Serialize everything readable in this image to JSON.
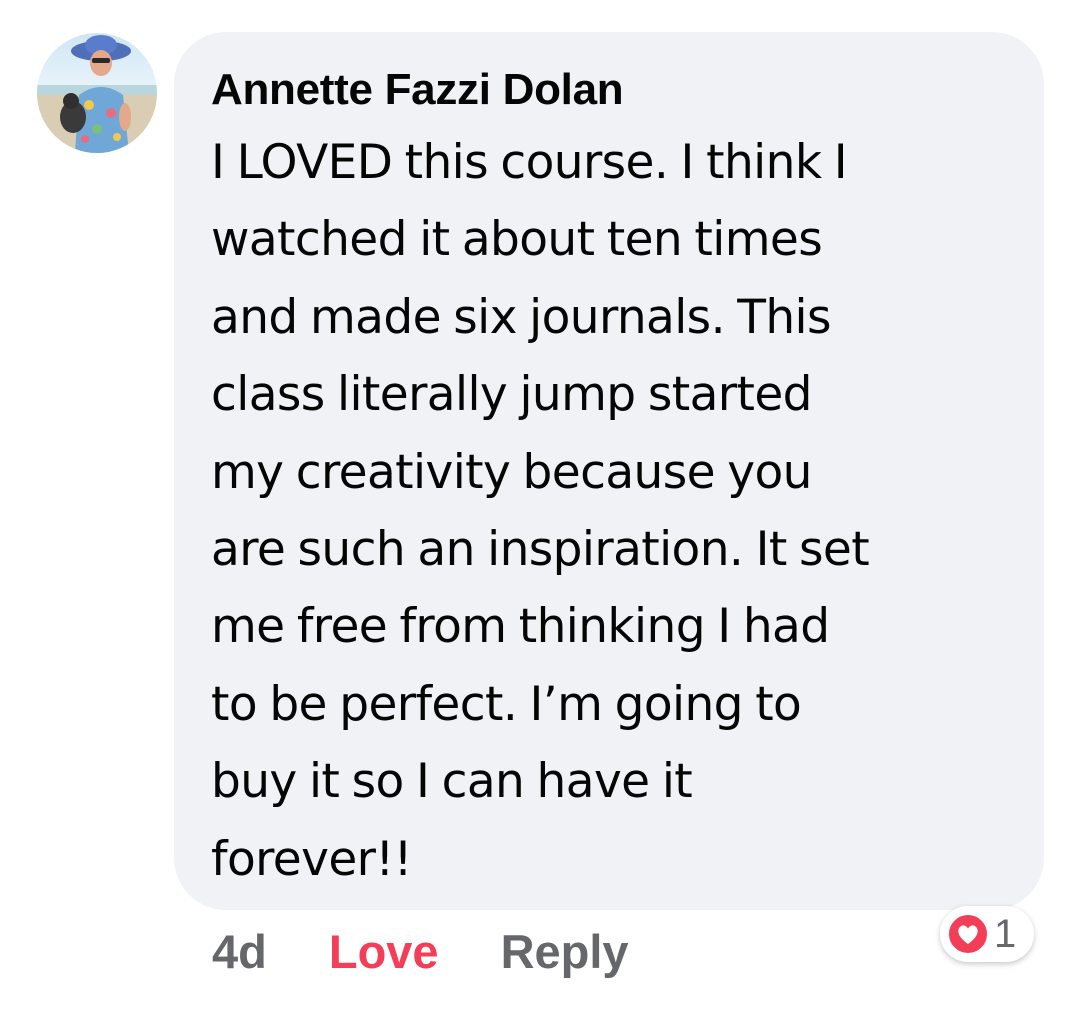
{
  "comment": {
    "author": "Annette Fazzi Dolan",
    "text": "I LOVED this course. I think I\nwatched it about ten times\nand made six journals. This\nclass literally jump started\nmy creativity because you\nare such an inspiration. It set\nme free from thinking I had\nto be perfect. I’m going to\nbuy it so I can have it\nforever!!",
    "bubble_color": "#f0f2f5"
  },
  "actions": {
    "timestamp": "4d",
    "love_label": "Love",
    "reply_label": "Reply",
    "love_color": "#f33e58"
  },
  "reactions": {
    "icon": "love-heart-icon",
    "count": "1"
  },
  "avatar": {
    "icon": "profile-photo"
  }
}
